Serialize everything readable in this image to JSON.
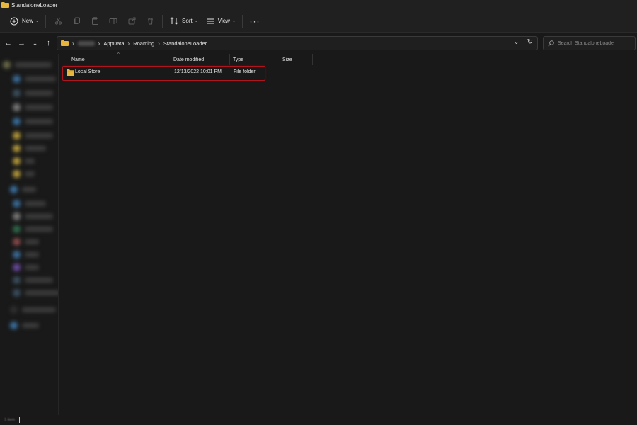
{
  "window": {
    "title": "StandaloneLoader"
  },
  "toolbar": {
    "new_label": "New",
    "sort_label": "Sort",
    "view_label": "View",
    "more_label": "···"
  },
  "address": {
    "segments": [
      "AppData",
      "Roaming",
      "StandaloneLoader"
    ]
  },
  "search": {
    "placeholder": "Search StandaloneLoader"
  },
  "columns": {
    "name": "Name",
    "date": "Date modified",
    "type": "Type",
    "size": "Size"
  },
  "files": [
    {
      "name": "Local Store",
      "date": "12/13/2022 10:01 PM",
      "type": "File folder",
      "size": ""
    }
  ],
  "status": {
    "items_count": "1 item"
  },
  "colors": {
    "background": "#191919",
    "toolbar": "#202020",
    "highlight_border": "#b0141e",
    "folder_yellow": "#e8b63c"
  }
}
